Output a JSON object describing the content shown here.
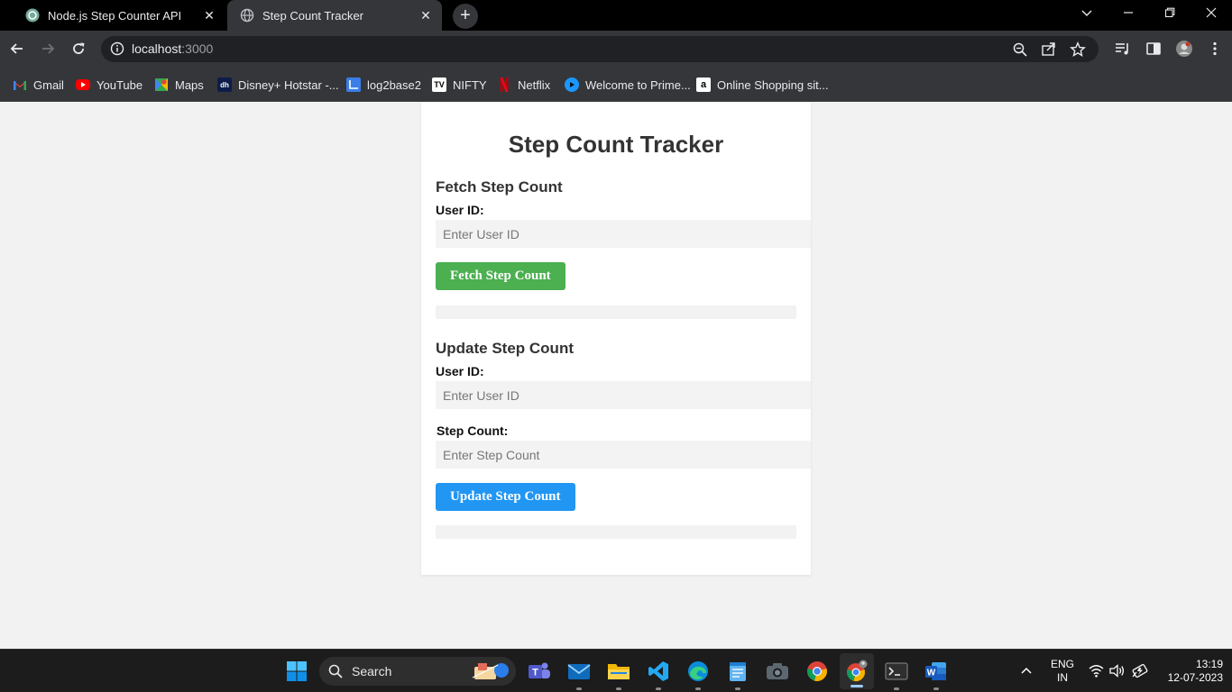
{
  "browser": {
    "tabs": [
      {
        "title": "Node.js Step Counter API",
        "active": false
      },
      {
        "title": "Step Count Tracker",
        "active": true
      }
    ],
    "url_host": "localhost",
    "url_port": ":3000",
    "bookmarks": [
      {
        "label": "Gmail",
        "icon": "gmail-icon"
      },
      {
        "label": "YouTube",
        "icon": "youtube-icon"
      },
      {
        "label": "Maps",
        "icon": "maps-icon"
      },
      {
        "label": "Disney+ Hotstar -...",
        "icon": "hotstar-icon"
      },
      {
        "label": "log2base2",
        "icon": "log2base2-icon"
      },
      {
        "label": "NIFTY",
        "icon": "nifty-icon"
      },
      {
        "label": "Netflix",
        "icon": "netflix-icon"
      },
      {
        "label": "Welcome to Prime...",
        "icon": "prime-video-icon"
      },
      {
        "label": "Online Shopping sit...",
        "icon": "amazon-icon"
      }
    ]
  },
  "page": {
    "title": "Step Count Tracker",
    "fetch": {
      "heading": "Fetch Step Count",
      "user_label": "User ID:",
      "user_placeholder": "Enter User ID",
      "button": "Fetch Step Count"
    },
    "update": {
      "heading": "Update Step Count",
      "user_label": "User ID:",
      "user_placeholder": "Enter User ID",
      "steps_label": "Step Count:",
      "steps_placeholder": "Enter Step Count",
      "button": "Update Step Count"
    }
  },
  "taskbar": {
    "search_label": "Search",
    "lang_line1": "ENG",
    "lang_line2": "IN",
    "time": "13:19",
    "date": "12-07-2023"
  },
  "colors": {
    "fetch_button": "#4caf50",
    "update_button": "#2196f3",
    "page_background": "#f2f2f2"
  }
}
